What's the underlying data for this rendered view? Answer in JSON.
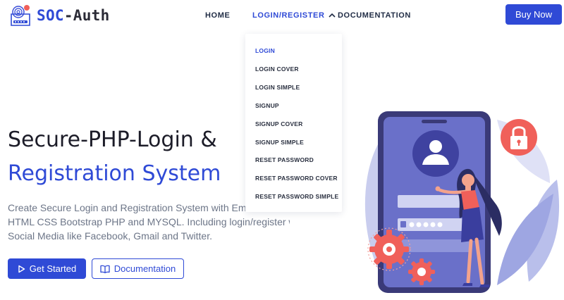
{
  "brand": {
    "soc": "SOC",
    "auth": "-Auth",
    "logo_icon": "fingerprint-lock-icon"
  },
  "nav": {
    "home": "HOME",
    "login_register": "LOGIN/REGISTER",
    "documentation": "DOCUMENTATION"
  },
  "buy_now": "Buy Now",
  "dropdown": {
    "items": [
      "LOGIN",
      "LOGIN COVER",
      "LOGIN SIMPLE",
      "SIGNUP",
      "SIGNUP COVER",
      "SIGNUP SIMPLE",
      "RESET PASSWORD",
      "RESET PASSWORD COVER",
      "RESET PASSWORD SIMPLE"
    ],
    "active_index": 0
  },
  "hero": {
    "title_line1": "Secure-PHP-Login &",
    "title_line2": "Registration System",
    "description_lines": [
      "Create Secure Login and Registration System with Email Verification",
      "HTML CSS Bootstrap PHP and MYSQL. Including login/register with",
      "Social Media like Facebook, Gmail and Twitter."
    ],
    "get_started": "Get Started",
    "documentation": "Documentation"
  },
  "icons": {
    "chevron": "chevron-up-icon",
    "play": "play-icon",
    "book": "book-icon",
    "lock": "padlock-icon",
    "user": "user-avatar-icon",
    "gear": "gear-icon"
  },
  "colors": {
    "primary": "#2f4ad6",
    "phone": "#6a70c9",
    "accent_red": "#f0605a",
    "dark_text": "#1c1c28",
    "muted_text": "#6d7688"
  }
}
